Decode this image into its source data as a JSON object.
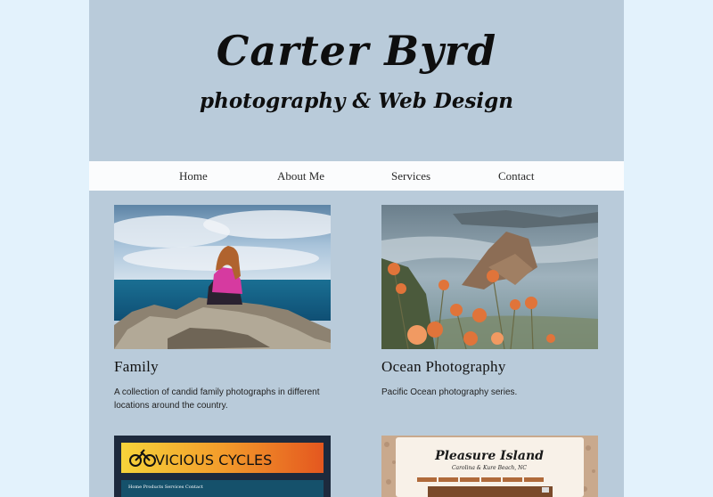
{
  "header": {
    "title": "Carter Byrd",
    "subtitle": "photography  & Web Design"
  },
  "nav": {
    "items": [
      "Home",
      "About Me",
      "Services",
      "Contact"
    ]
  },
  "cards": [
    {
      "title": "Family",
      "description": "A collection of candid family photographs in different locations around the country."
    },
    {
      "title": "Ocean Photography",
      "description": "Pacific Ocean photography series."
    }
  ],
  "thumbnails": {
    "vicious": {
      "logo_text": "VICIOUS CYCLES",
      "nav_text": "Home  Products  Services  Contact"
    },
    "pleasure": {
      "title": "Pleasure Island",
      "subtitle": "Carolina & Kure Beach, NC"
    }
  },
  "colors": {
    "page_background": "#e3f2fc",
    "content_background": "#b9cbda",
    "nav_background": "#fbfcfd"
  }
}
